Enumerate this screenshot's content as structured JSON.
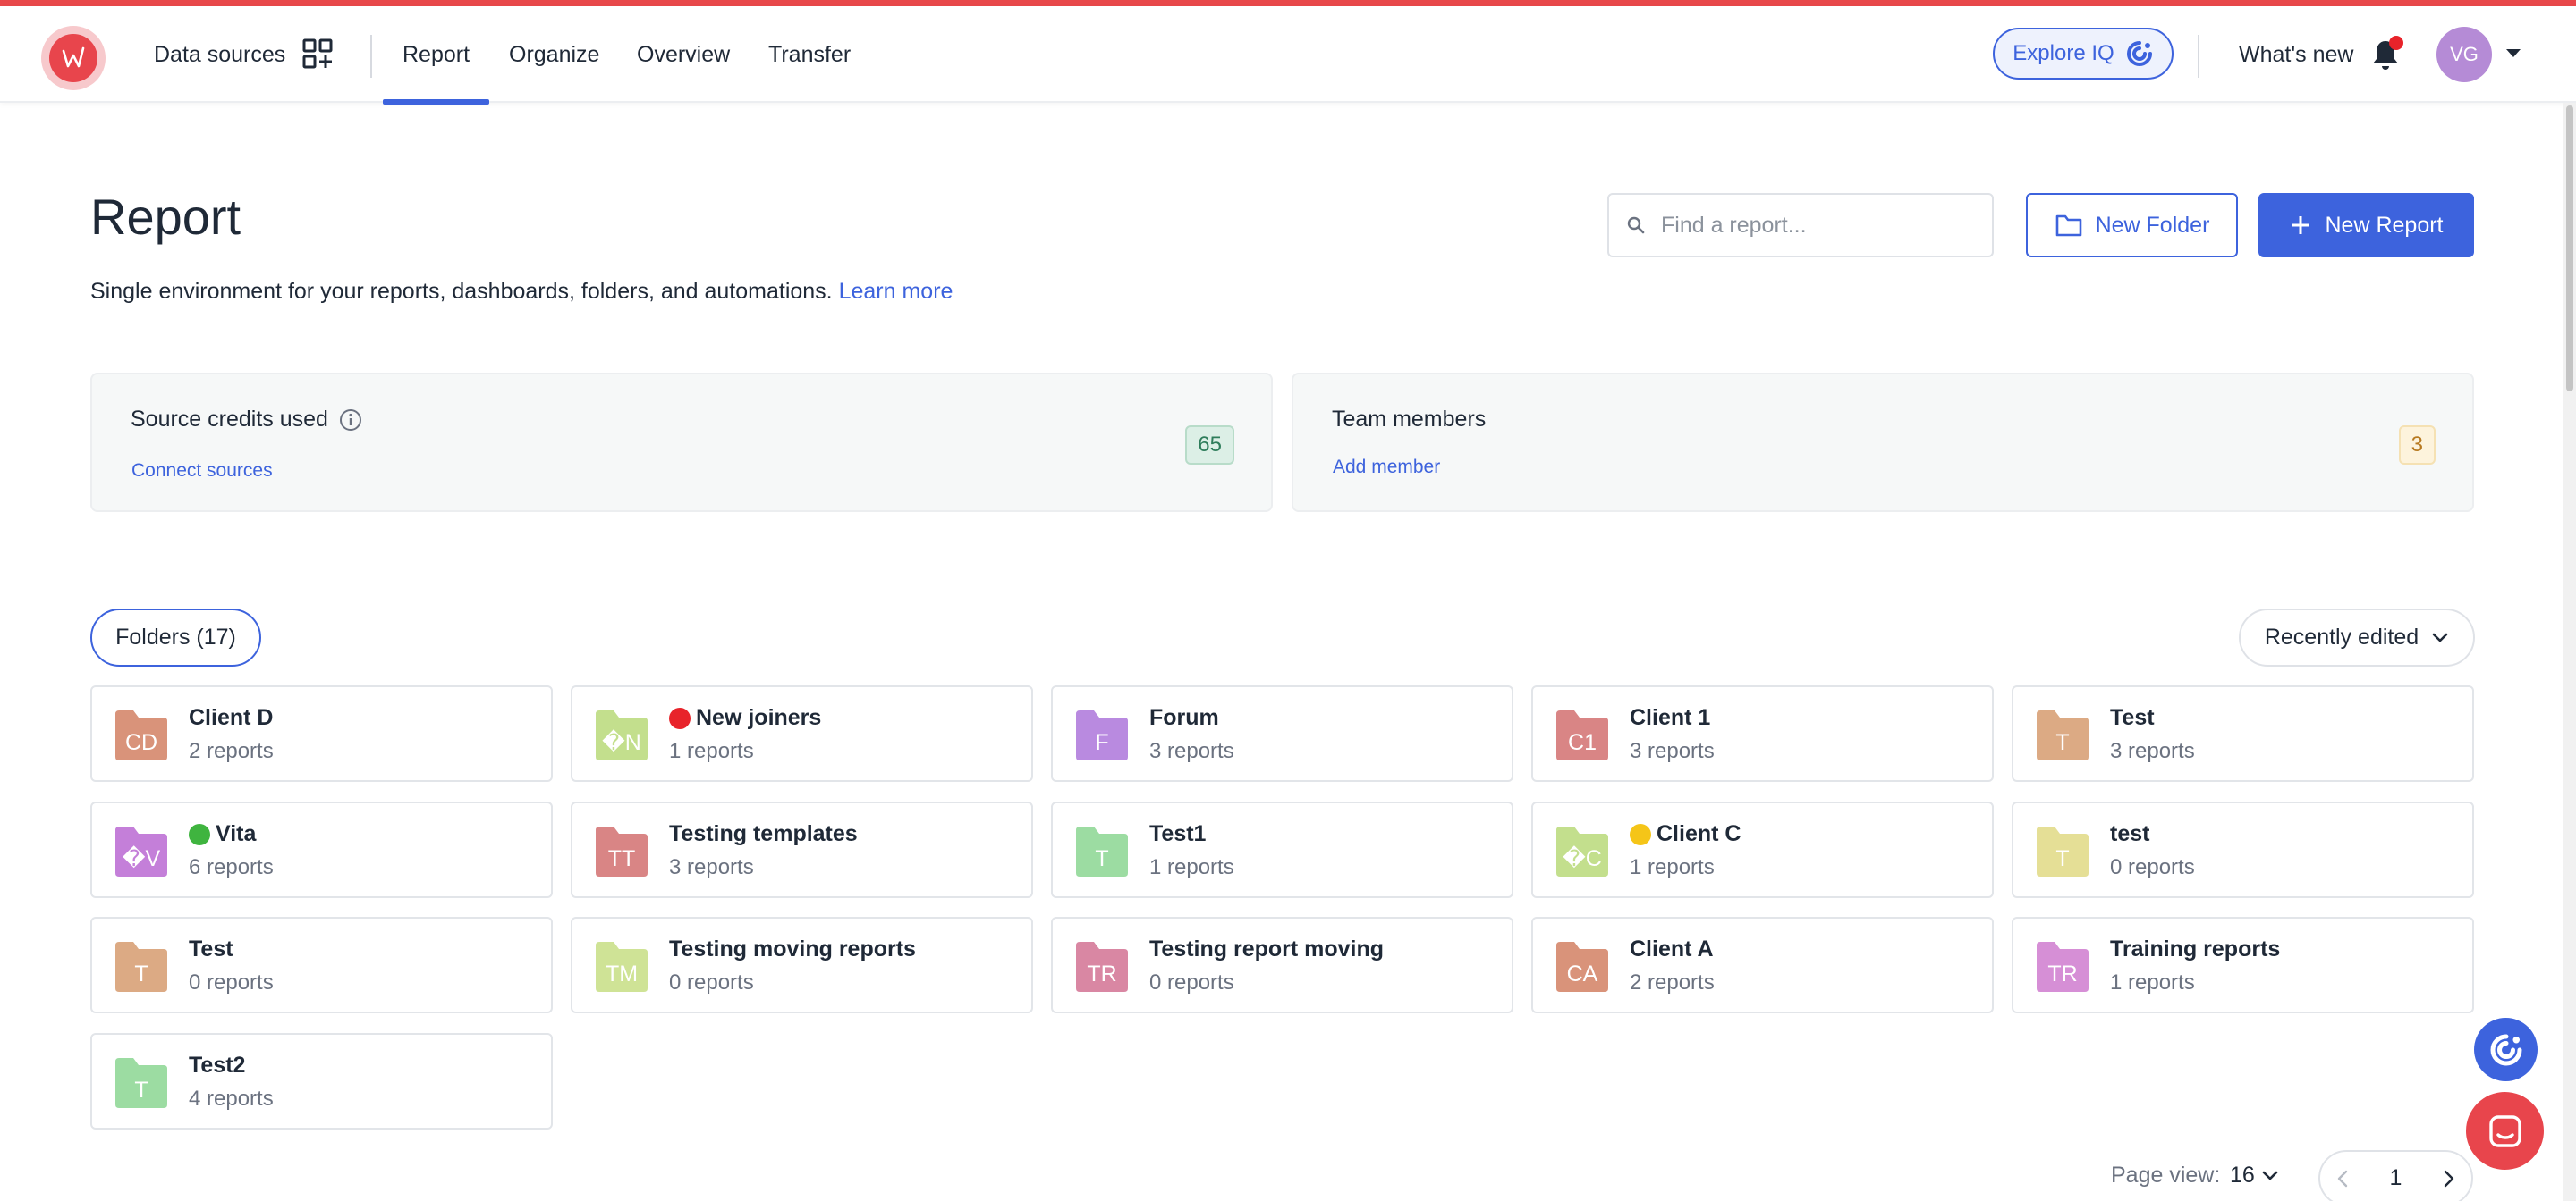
{
  "nav": {
    "data_sources": "Data sources",
    "items": [
      {
        "label": "Report",
        "active": true
      },
      {
        "label": "Organize",
        "active": false
      },
      {
        "label": "Overview",
        "active": false
      },
      {
        "label": "Transfer",
        "active": false
      }
    ],
    "explore": "Explore IQ",
    "whats_new": "What's new",
    "avatar_initials": "VG"
  },
  "page": {
    "title": "Report",
    "subtitle": "Single environment for your reports, dashboards, folders, and automations.",
    "learn_more": "Learn more"
  },
  "search": {
    "placeholder": "Find a report..."
  },
  "buttons": {
    "new_folder": "New Folder",
    "new_report": "New Report"
  },
  "stats": {
    "credits": {
      "title": "Source credits used",
      "link": "Connect sources",
      "value": "65"
    },
    "team": {
      "title": "Team members",
      "link": "Add member",
      "value": "3"
    }
  },
  "folders": {
    "pill": "Folders (17)",
    "sort": "Recently edited",
    "items": [
      {
        "initials": "CD",
        "name": "Client D",
        "count": "2 reports",
        "color": "#d9937a",
        "emoji": ""
      },
      {
        "initials": "�N",
        "name": "New joiners",
        "count": "1 reports",
        "color": "#c3df8d",
        "emoji": "red"
      },
      {
        "initials": "F",
        "name": "Forum",
        "count": "3 reports",
        "color": "#b98ae0",
        "emoji": ""
      },
      {
        "initials": "C1",
        "name": "Client 1",
        "count": "3 reports",
        "color": "#d98585",
        "emoji": ""
      },
      {
        "initials": "T",
        "name": "Test",
        "count": "3 reports",
        "color": "#dcaa84",
        "emoji": ""
      },
      {
        "initials": "�V",
        "name": "Vita",
        "count": "6 reports",
        "color": "#c47fd9",
        "emoji": "green"
      },
      {
        "initials": "TT",
        "name": "Testing templates",
        "count": "3 reports",
        "color": "#d98585",
        "emoji": ""
      },
      {
        "initials": "T",
        "name": "Test1",
        "count": "1 reports",
        "color": "#9cdca2",
        "emoji": ""
      },
      {
        "initials": "�C",
        "name": "Client C",
        "count": "1 reports",
        "color": "#c3df8d",
        "emoji": "yellow"
      },
      {
        "initials": "T",
        "name": "test",
        "count": "0 reports",
        "color": "#e5df96",
        "emoji": ""
      },
      {
        "initials": "T",
        "name": "Test",
        "count": "0 reports",
        "color": "#dcaa84",
        "emoji": ""
      },
      {
        "initials": "TM",
        "name": "Testing moving reports",
        "count": "0 reports",
        "color": "#cfe396",
        "emoji": ""
      },
      {
        "initials": "TR",
        "name": "Testing report moving",
        "count": "0 reports",
        "color": "#d987a3",
        "emoji": ""
      },
      {
        "initials": "CA",
        "name": "Client A",
        "count": "2 reports",
        "color": "#d9937a",
        "emoji": ""
      },
      {
        "initials": "TR",
        "name": "Training reports",
        "count": "1 reports",
        "color": "#d68fd6",
        "emoji": ""
      },
      {
        "initials": "T",
        "name": "Test2",
        "count": "4 reports",
        "color": "#9cdca2",
        "emoji": ""
      }
    ]
  },
  "pager": {
    "label": "Page view:",
    "size": "16",
    "page": "1"
  },
  "colors": {
    "accent": "#3d63dd",
    "brand_red": "#e8454c"
  }
}
